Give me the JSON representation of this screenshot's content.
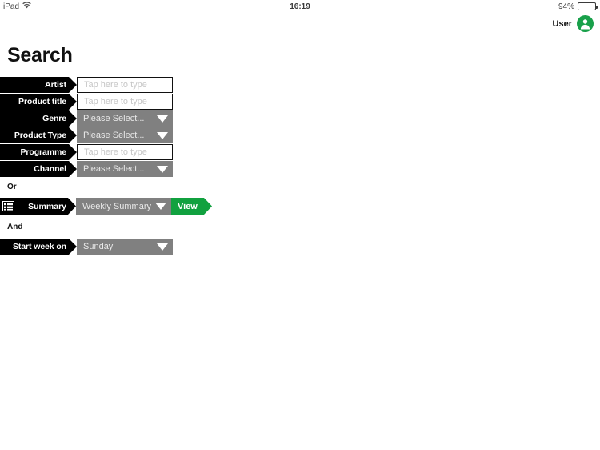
{
  "status_bar": {
    "device": "iPad",
    "wifi_icon": "wifi-icon",
    "time": "16:19",
    "battery_percent": "94%",
    "battery_level": 94
  },
  "user_bar": {
    "label": "User",
    "avatar_icon": "user-avatar-icon",
    "avatar_color": "#18a04a"
  },
  "page": {
    "title": "Search"
  },
  "form": {
    "rows": [
      {
        "label": "Artist",
        "type": "text",
        "placeholder": "Tap here to type",
        "value": ""
      },
      {
        "label": "Product title",
        "type": "text",
        "placeholder": "Tap here to type",
        "value": ""
      },
      {
        "label": "Genre",
        "type": "select",
        "value": "Please Select..."
      },
      {
        "label": "Product Type",
        "type": "select",
        "value": "Please Select..."
      },
      {
        "label": "Programme",
        "type": "text",
        "placeholder": "Tap here to type",
        "value": ""
      },
      {
        "label": "Channel",
        "type": "select",
        "value": "Please Select..."
      }
    ]
  },
  "or_section": {
    "word": "Or",
    "grid_icon": "grid-icon",
    "summary_label": "Summary",
    "summary_value": "Weekly Summary",
    "view_button": "View",
    "view_button_color": "#11a13f"
  },
  "and_section": {
    "word": "And",
    "start_week_label": "Start week on",
    "start_week_value": "Sunday"
  }
}
